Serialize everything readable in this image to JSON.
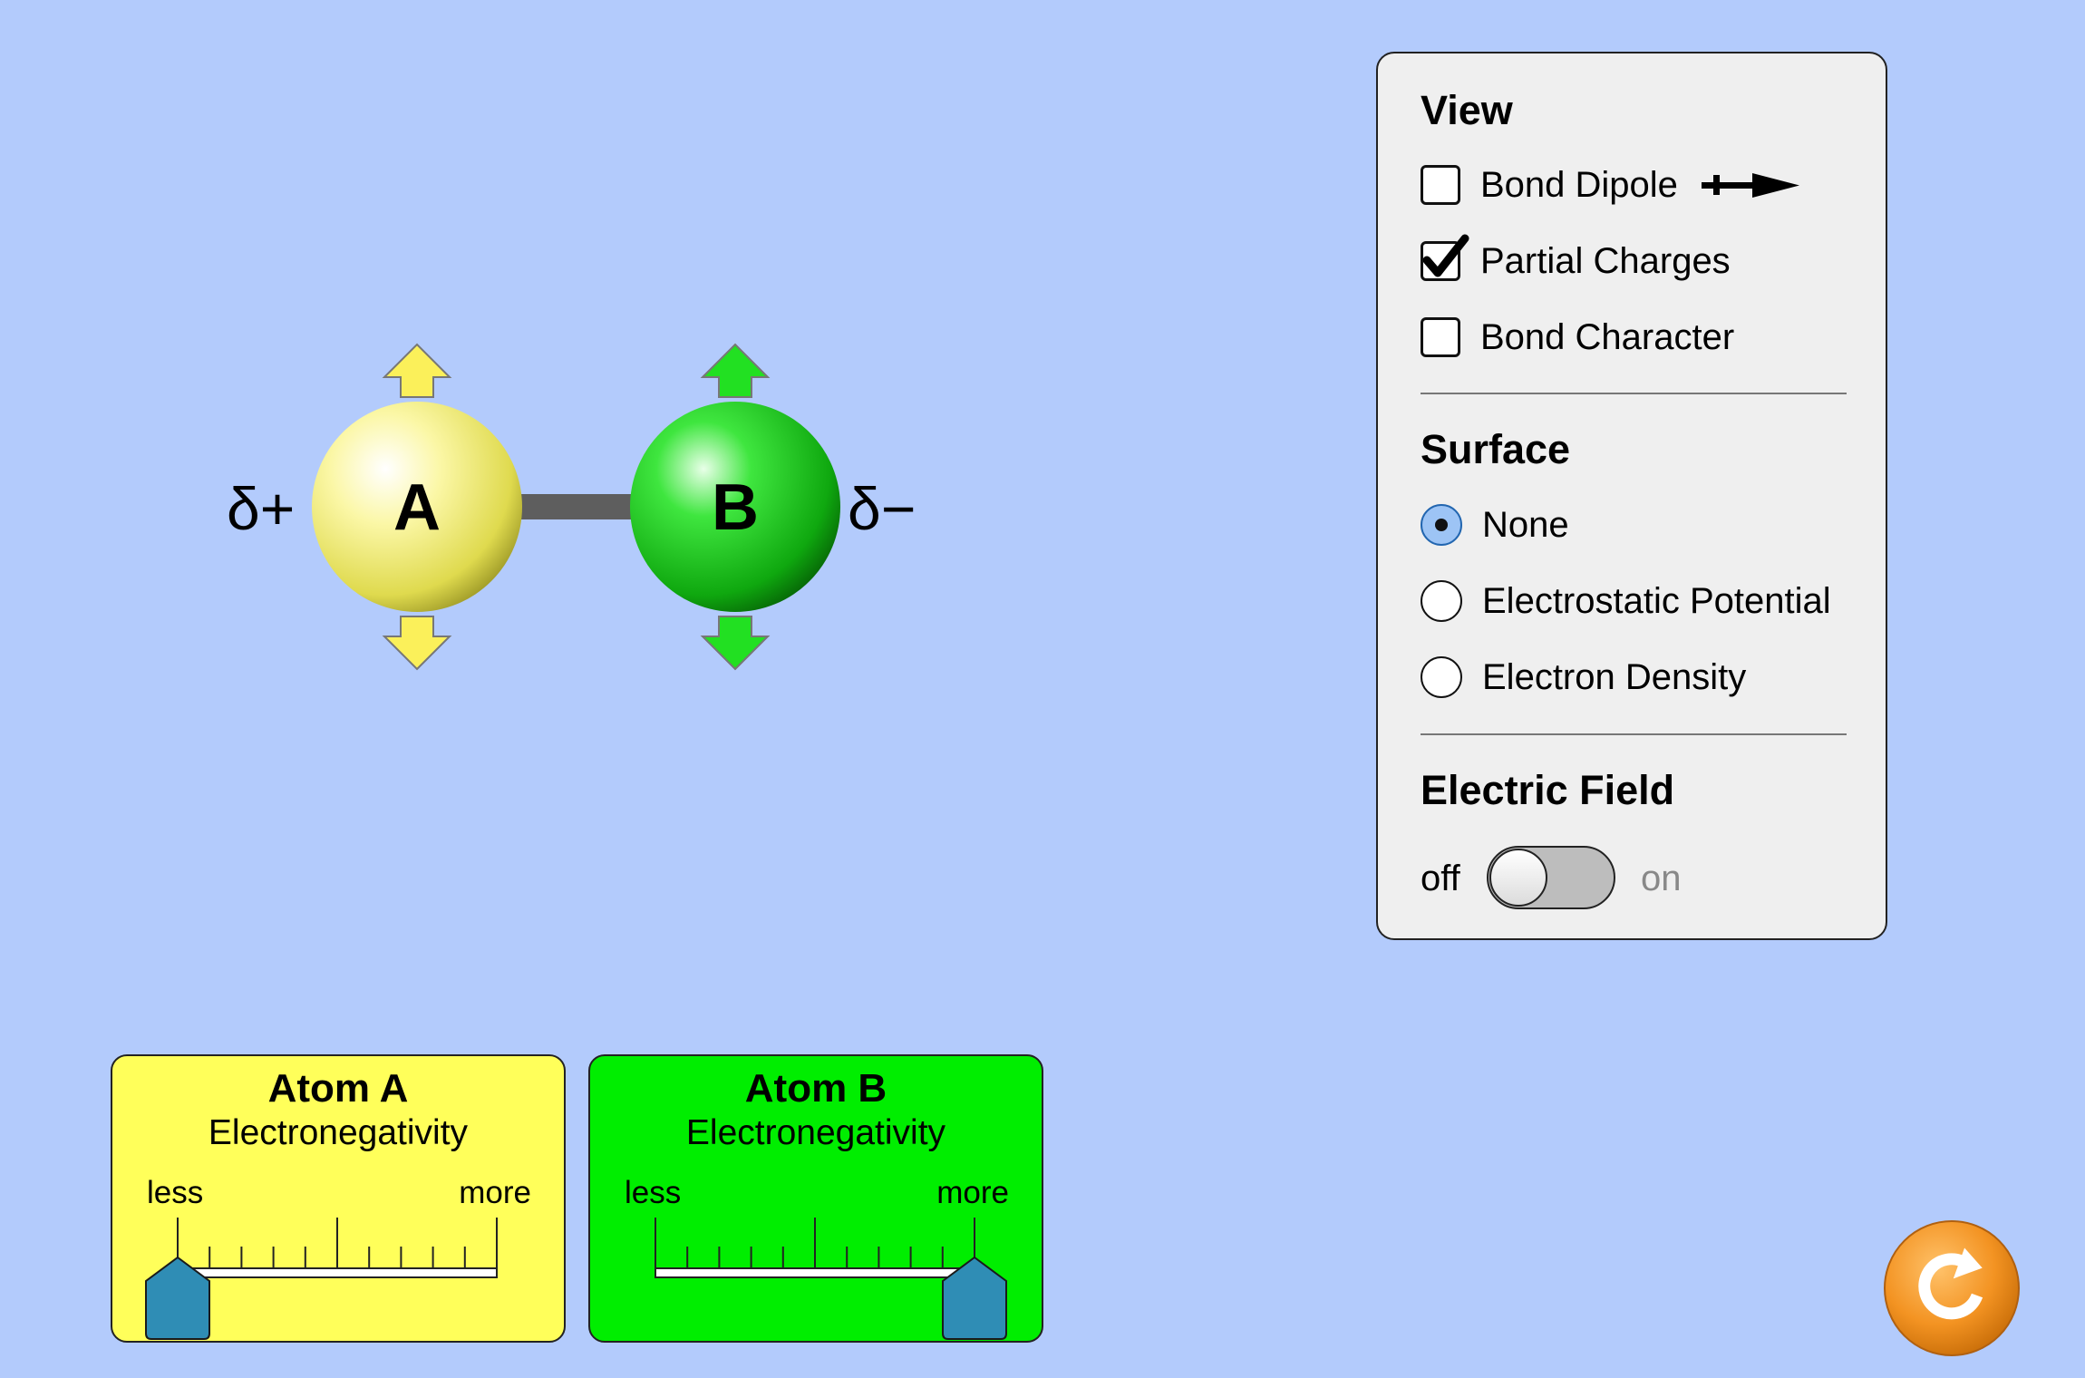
{
  "molecule": {
    "atom_a": {
      "label": "A",
      "partial_charge": "δ+",
      "color": "#f6f26a"
    },
    "atom_b": {
      "label": "B",
      "partial_charge": "δ−",
      "color": "#17c617"
    }
  },
  "panel": {
    "view": {
      "title": "View",
      "options": [
        {
          "label": "Bond Dipole",
          "checked": false,
          "icon": "dipole-arrow-icon"
        },
        {
          "label": "Partial Charges",
          "checked": true
        },
        {
          "label": "Bond Character",
          "checked": false
        }
      ]
    },
    "surface": {
      "title": "Surface",
      "options": [
        {
          "label": "None",
          "selected": true
        },
        {
          "label": "Electrostatic Potential",
          "selected": false
        },
        {
          "label": "Electron Density",
          "selected": false
        }
      ]
    },
    "electric_field": {
      "title": "Electric Field",
      "off_label": "off",
      "on_label": "on",
      "enabled": false
    }
  },
  "cards": {
    "atom_a": {
      "title": "Atom A",
      "subtitle": "Electronegativity",
      "less_label": "less",
      "more_label": "more",
      "value_fraction": 0.0,
      "color": "#ffff5a"
    },
    "atom_b": {
      "title": "Atom B",
      "subtitle": "Electronegativity",
      "less_label": "less",
      "more_label": "more",
      "value_fraction": 1.0,
      "color": "#00ee00"
    }
  },
  "reset": {
    "icon": "reset-icon",
    "color": "#f39322"
  }
}
